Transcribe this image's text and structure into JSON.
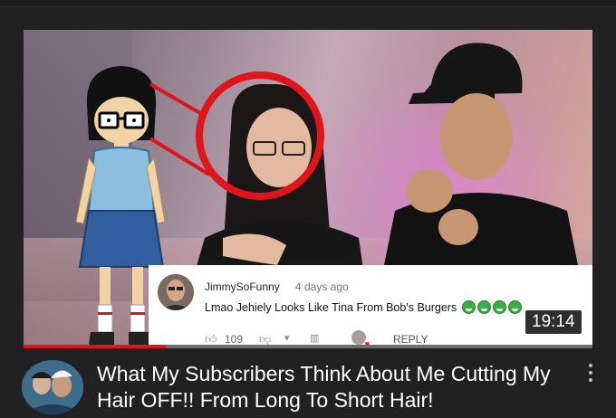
{
  "thumbnail": {
    "duration": "19:14",
    "progress_fraction": 0.25
  },
  "comment": {
    "author": "JimmySoFunny",
    "time": "4 days ago",
    "text": "Lmao Jehiely Looks Like Tina From Bob's Burgers",
    "like_count": "109",
    "reply_label": "REPLY"
  },
  "video": {
    "title": "What My Subscribers Think About Me Cutting My Hair OFF!! From Long To Short Hair!"
  },
  "icons": {
    "like": "thumbs-up-icon",
    "dislike": "thumbs-down-icon",
    "more": "more-vert-icon"
  },
  "colors": {
    "background": "#212121",
    "accent_red": "#e0141b",
    "badge_bg": "#000000"
  }
}
